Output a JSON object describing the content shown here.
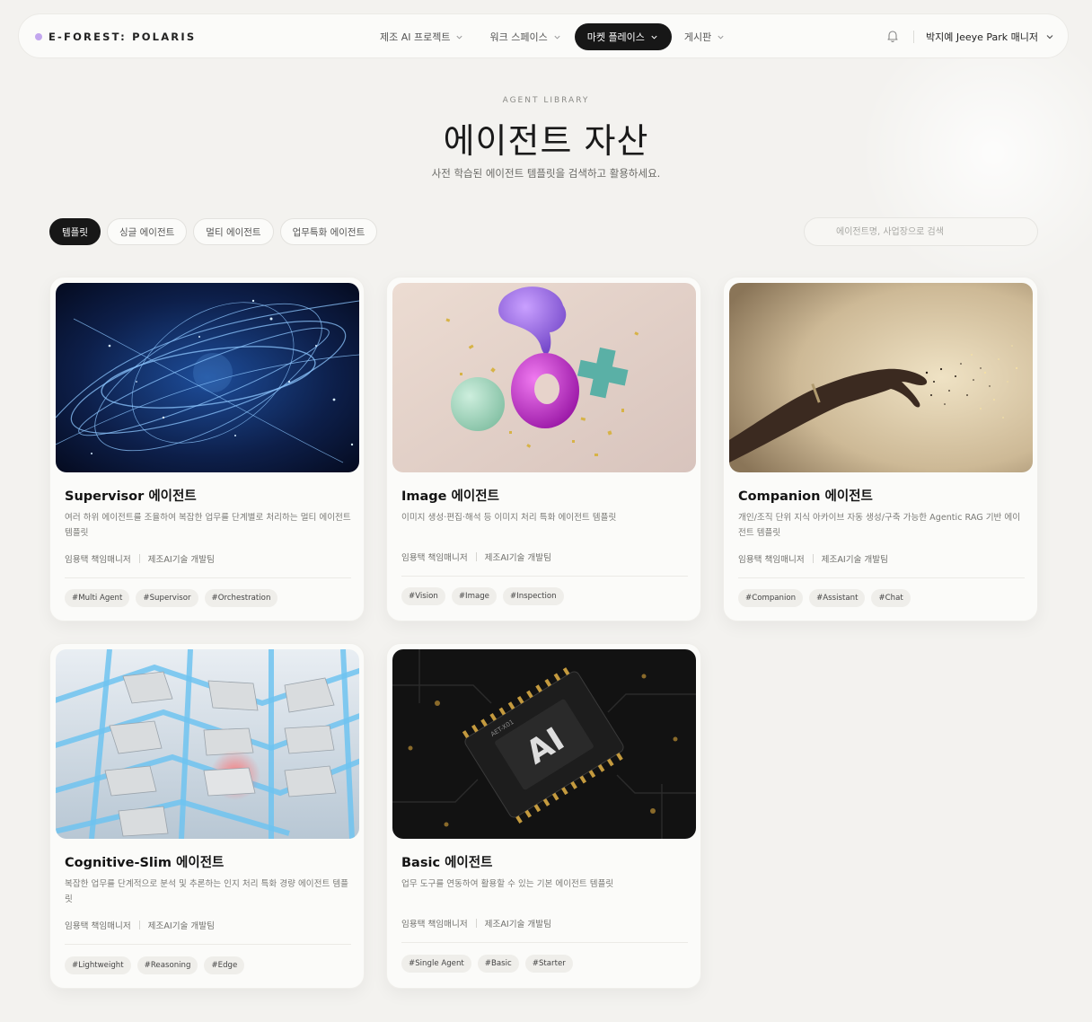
{
  "brand": {
    "name": "E-FOREST: POLARIS"
  },
  "nav": {
    "items": [
      {
        "label": "제조 AI 프로젝트"
      },
      {
        "label": "워크 스페이스"
      },
      {
        "label": "마켓 플레이스"
      },
      {
        "label": "게시판"
      }
    ],
    "active_index": 2
  },
  "user": {
    "name": "박지예 Jeeye Park 매니저"
  },
  "hero": {
    "eyebrow": "AGENT LIBRARY",
    "title": "에이전트 자산",
    "subtitle": "사전 학습된 에이전트 템플릿을 검색하고 활용하세요."
  },
  "filters": {
    "chips": [
      {
        "label": "템플릿"
      },
      {
        "label": "싱글 에이전트"
      },
      {
        "label": "멀티 에이전트"
      },
      {
        "label": "업무특화 에이전트"
      }
    ],
    "active_index": 0
  },
  "search": {
    "placeholder": "에이전트명, 사업장으로 검색",
    "value": ""
  },
  "cards": [
    {
      "title": "Supervisor 에이전트",
      "description": "여러 하위 에이전트를 조율하여 복잡한 업무를 단계별로 처리하는 멀티 에이전트 템플릿",
      "owner": "임용택 책임매니저",
      "team": "제조AI기술 개발팀",
      "tags": [
        "#Multi Agent",
        "#Supervisor",
        "#Orchestration"
      ]
    },
    {
      "title": "Image 에이전트",
      "description": "이미지 생성·편집·해석 등 이미지 처리 특화 에이전트 템플릿",
      "owner": "임용택 책임매니저",
      "team": "제조AI기술 개발팀",
      "tags": [
        "#Vision",
        "#Image",
        "#Inspection"
      ]
    },
    {
      "title": "Companion 에이전트",
      "description": "개인/조직 단위 지식 아카이브 자동 생성/구축 가능한 Agentic RAG 기반 에이전트 템플릿",
      "owner": "임용택 책임매니저",
      "team": "제조AI기술 개발팀",
      "tags": [
        "#Companion",
        "#Assistant",
        "#Chat"
      ]
    },
    {
      "title": "Cognitive-Slim 에이전트",
      "description": "복잡한 업무를 단계적으로 분석 및 추론하는 인지 처리 특화 경량 에이전트 템플릿",
      "owner": "임용택 책임매니저",
      "team": "제조AI기술 개발팀",
      "tags": [
        "#Lightweight",
        "#Reasoning",
        "#Edge"
      ]
    },
    {
      "title": "Basic 에이전트",
      "description": "업무 도구를 연동하여 활용할 수 있는 기본 에이전트 템플릿",
      "owner": "임용택 책임매니저",
      "team": "제조AI기술 개발팀",
      "tags": [
        "#Single Agent",
        "#Basic",
        "#Starter"
      ]
    }
  ],
  "chip_text": {
    "ai": "AI",
    "model": "AET-X01"
  },
  "colors": {
    "accent_dark": "#171717",
    "brand_dot": "#c2a6ee",
    "background": "#f3f2ef"
  }
}
